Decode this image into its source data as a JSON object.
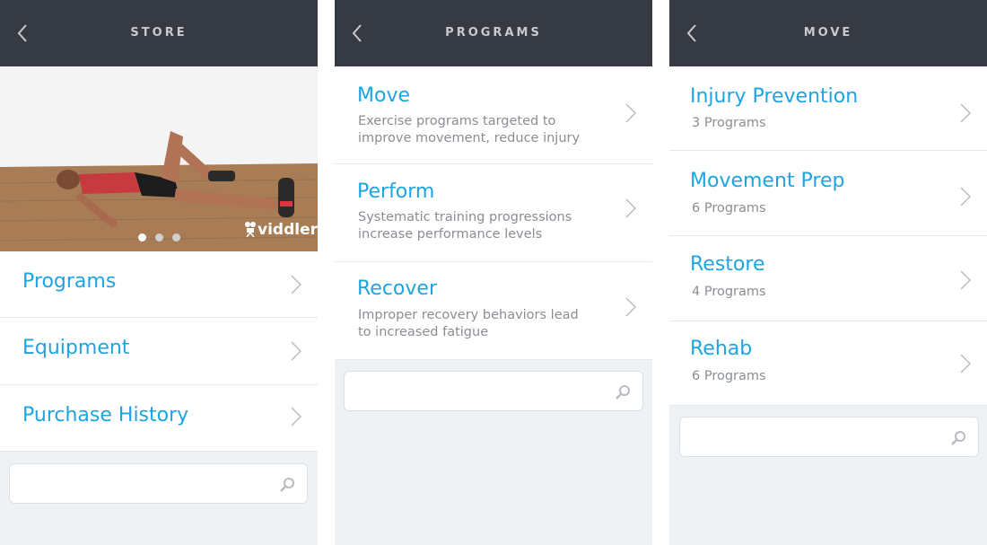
{
  "store": {
    "title": "STORE",
    "carousel": {
      "slides": 3,
      "active": 0,
      "watermark": "viddler"
    },
    "items": [
      {
        "label": "Programs"
      },
      {
        "label": "Equipment"
      },
      {
        "label": "Purchase History"
      }
    ],
    "search": {
      "placeholder": "",
      "value": ""
    }
  },
  "programs": {
    "title": "PROGRAMS",
    "items": [
      {
        "label": "Move",
        "description": "Exercise programs targeted to improve movement, reduce injury",
        "line1": "Exercise programs targeted to",
        "line2": "improve movement, reduce injury"
      },
      {
        "label": "Perform",
        "description": "Systematic training progressions increase performance levels",
        "line1": "Systematic training progressions",
        "line2": "increase performance levels"
      },
      {
        "label": "Recover",
        "description": "Improper recovery behaviors lead to increased fatigue",
        "line1": "Improper recovery behaviors lead",
        "line2": "to increased fatigue"
      }
    ],
    "search": {
      "placeholder": "",
      "value": ""
    }
  },
  "move": {
    "title": "MOVE",
    "items": [
      {
        "label": "Injury Prevention",
        "count": "3 Programs"
      },
      {
        "label": "Movement Prep",
        "count": "6 Programs"
      },
      {
        "label": "Restore",
        "count": "4 Programs"
      },
      {
        "label": "Rehab",
        "count": "6 Programs"
      }
    ],
    "search": {
      "placeholder": "",
      "value": ""
    }
  },
  "icons": {
    "back": "chevron-left-icon",
    "row": "chevron-right-icon",
    "search": "search-icon"
  },
  "colors": {
    "header": "#363a43",
    "accent": "#1da4e1",
    "background": "#eff2f5",
    "subtext": "#8a8e94"
  }
}
